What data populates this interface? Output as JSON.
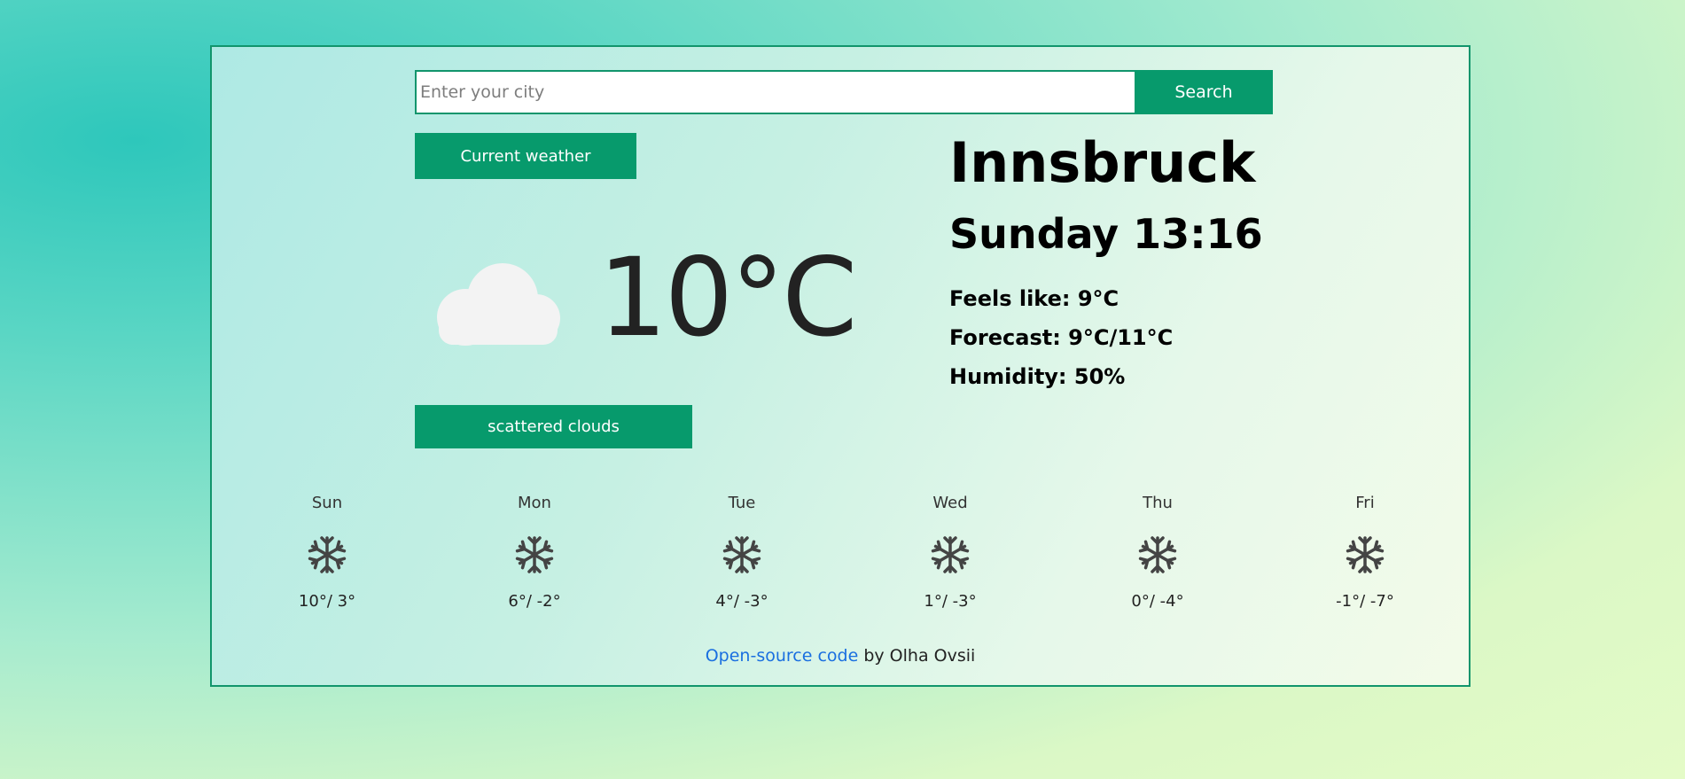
{
  "search": {
    "placeholder": "Enter your city",
    "button_label": "Search"
  },
  "current": {
    "button_label": "Current weather",
    "temperature": "10°C",
    "description": "scattered clouds",
    "icon": "cloud-icon"
  },
  "location": {
    "city": "Innsbruck",
    "datetime": "Sunday 13:16",
    "feels_like": "Feels like: 9°C",
    "forecast": "Forecast: 9°C/11°C",
    "humidity": "Humidity: 50%"
  },
  "daily": [
    {
      "day": "Sun",
      "temps": "10°/ 3°",
      "icon": "snowflake-icon"
    },
    {
      "day": "Mon",
      "temps": "6°/ -2°",
      "icon": "snowflake-icon"
    },
    {
      "day": "Tue",
      "temps": "4°/ -3°",
      "icon": "snowflake-icon"
    },
    {
      "day": "Wed",
      "temps": "1°/ -3°",
      "icon": "snowflake-icon"
    },
    {
      "day": "Thu",
      "temps": "0°/ -4°",
      "icon": "snowflake-icon"
    },
    {
      "day": "Fri",
      "temps": "-1°/ -7°",
      "icon": "snowflake-icon"
    }
  ],
  "footer": {
    "link_text": "Open-source code",
    "suffix": " by Olha Ovsii"
  },
  "colors": {
    "accent": "#079a6c",
    "border": "#11956c",
    "link": "#1a6fe0"
  }
}
